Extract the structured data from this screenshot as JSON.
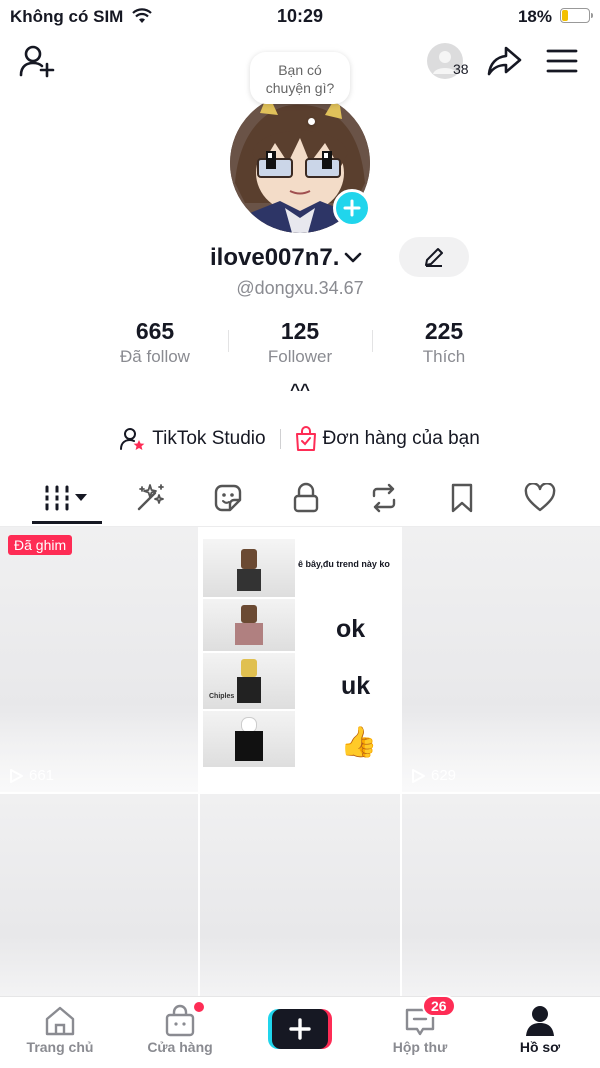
{
  "status_bar": {
    "carrier": "Không có SIM",
    "time": "10:29",
    "battery": "18%"
  },
  "header": {
    "viewer_count": "38"
  },
  "profile": {
    "bubble_text": [
      "Bạn có",
      "chuyện gì?"
    ],
    "username": "ilove007n7.",
    "handle": "@dongxu.34.67",
    "stats": [
      {
        "value": "665",
        "label": "Đã follow"
      },
      {
        "value": "125",
        "label": "Follower"
      },
      {
        "value": "225",
        "label": "Thích"
      }
    ],
    "expand": "^^"
  },
  "links": {
    "studio": "TikTok Studio",
    "orders": "Đơn hàng của bạn"
  },
  "videos": [
    {
      "badge": "Đã ghim",
      "views": "661"
    },
    {
      "overlay_lines": [
        "ê bây,đu trend này ko",
        "ok",
        "uk",
        "👍"
      ],
      "watermark": "Chiples",
      "views": "..."
    },
    {
      "views": "629"
    }
  ],
  "nav": {
    "home": "Trang chủ",
    "shop": "Cửa hàng",
    "inbox": "Hộp thư",
    "inbox_badge": "26",
    "profile": "Hồ sơ"
  },
  "colors": {
    "accent": "#fe2c55",
    "cyan": "#20d5ec",
    "text": "#161823",
    "muted": "#8a8b91"
  }
}
